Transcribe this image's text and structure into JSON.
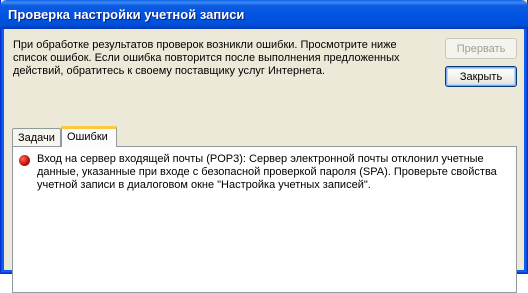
{
  "window": {
    "title": "Проверка настройки учетной записи"
  },
  "message": {
    "text": "При обработке результатов проверок возникли ошибки. Просмотрите ниже список ошибок. Если ошибка повторится после выполнения предложенных действий, обратитесь к своему поставщику услуг Интернета."
  },
  "buttons": {
    "retry_label": "Прервать",
    "close_label": "Закрыть"
  },
  "tabs": [
    {
      "label": "Задачи",
      "active": false
    },
    {
      "label": "Ошибки",
      "active": true
    }
  ],
  "errors": [
    {
      "icon": "error-icon",
      "text": "Вход на сервер входящей почты (POP3): Сервер электронной почты отклонил учетные данные, указанные при входе с безопасной проверкой пароля (SPA). Проверьте свойства учетной записи в диалоговом окне \"Настройка учетных записей\"."
    }
  ],
  "colors": {
    "titlebar": "#0054e3",
    "window_bg": "#ece9d8",
    "tab_accent": "#ffc83c",
    "error_red": "#c8100a"
  }
}
